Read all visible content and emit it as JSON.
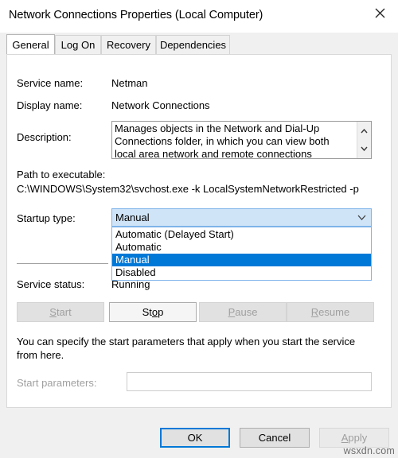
{
  "window": {
    "title": "Network Connections Properties (Local Computer)",
    "close_icon": "close-icon"
  },
  "tabs": [
    {
      "label": "General",
      "active": true
    },
    {
      "label": "Log On",
      "active": false
    },
    {
      "label": "Recovery",
      "active": false
    },
    {
      "label": "Dependencies",
      "active": false
    }
  ],
  "general": {
    "service_name_label": "Service name:",
    "service_name_value": "Netman",
    "display_name_label": "Display name:",
    "display_name_value": "Network Connections",
    "description_label": "Description:",
    "description_value": "Manages objects in the Network and Dial-Up Connections folder, in which you can view both local area network and remote connections",
    "path_label": "Path to executable:",
    "path_value": "C:\\WINDOWS\\System32\\svchost.exe -k LocalSystemNetworkRestricted -p",
    "startup_label": "Startup type:",
    "startup_value": "Manual",
    "startup_options": [
      "Automatic (Delayed Start)",
      "Automatic",
      "Manual",
      "Disabled"
    ],
    "status_label": "Service status:",
    "status_value": "Running",
    "hint_text": "You can specify the start parameters that apply when you start the service from here.",
    "param_label": "Start parameters:",
    "param_value": ""
  },
  "control_buttons": [
    {
      "label": "Start",
      "accel": "S",
      "enabled": false
    },
    {
      "label": "Stop",
      "accel": "o",
      "enabled": true
    },
    {
      "label": "Pause",
      "accel": "P",
      "enabled": false
    },
    {
      "label": "Resume",
      "accel": "R",
      "enabled": false
    }
  ],
  "footer": {
    "ok_label": "OK",
    "cancel_label": "Cancel",
    "apply_label": "Apply",
    "apply_enabled": false
  },
  "watermark": "wsxdn.com",
  "colors": {
    "accent_blue": "#0078d7",
    "combo_fill": "#cfe4f7",
    "dialog_bg": "#f0f0f0"
  }
}
